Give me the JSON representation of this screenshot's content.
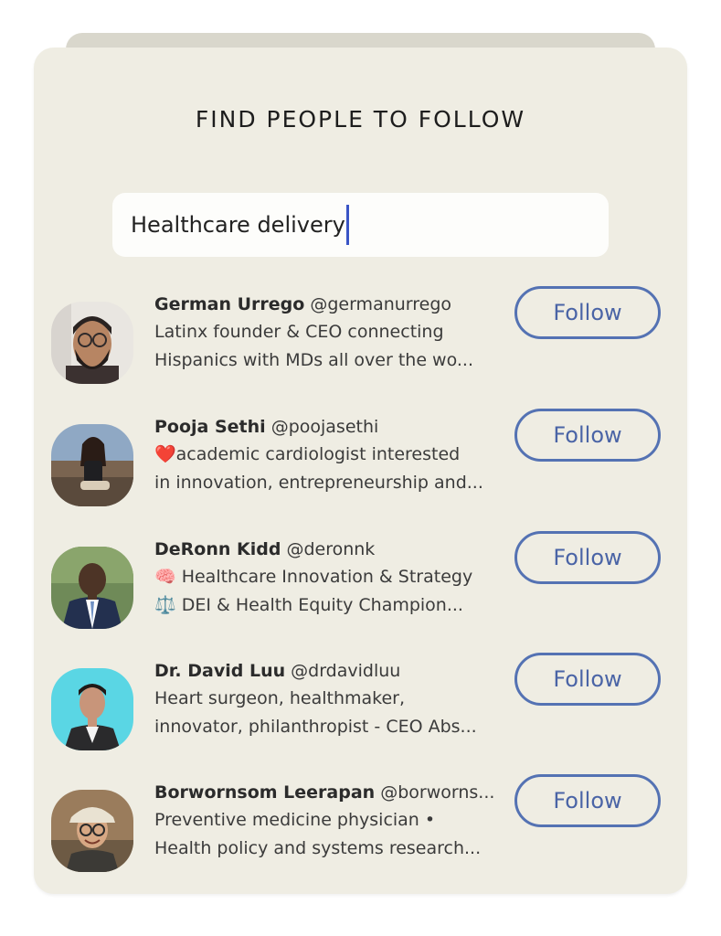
{
  "title": "FIND PEOPLE TO FOLLOW",
  "search": {
    "value": "Healthcare delivery"
  },
  "people": [
    {
      "name": "German Urrego",
      "handle": "@germanurrego",
      "bio1": "Latinx founder & CEO connecting",
      "bio2": "Hispanics with MDs all over the wo...",
      "follow": "Follow"
    },
    {
      "name": "Pooja Sethi",
      "handle": "@poojasethi",
      "bio1": "❤️academic cardiologist interested",
      "bio2": "in innovation, entrepreneurship and...",
      "follow": "Follow"
    },
    {
      "name": "DeRonn Kidd",
      "handle": "@deronnk",
      "bio1": "🧠 Healthcare Innovation & Strategy",
      "bio2": "⚖️ DEI & Health Equity Champion...",
      "follow": "Follow"
    },
    {
      "name": "Dr. David Luu",
      "handle": "@drdavidluu",
      "bio1": "Heart surgeon, healthmaker,",
      "bio2": "innovator, philanthropist - CEO Abs...",
      "follow": "Follow"
    },
    {
      "name": "Borwornsom Leerapan",
      "handle": "@borworns...",
      "bio1": "Preventive medicine physician •",
      "bio2": "Health policy and systems research...",
      "follow": "Follow"
    }
  ],
  "colors": {
    "card": "#efede3",
    "accent": "#5472b3",
    "caret": "#3a55c6"
  }
}
